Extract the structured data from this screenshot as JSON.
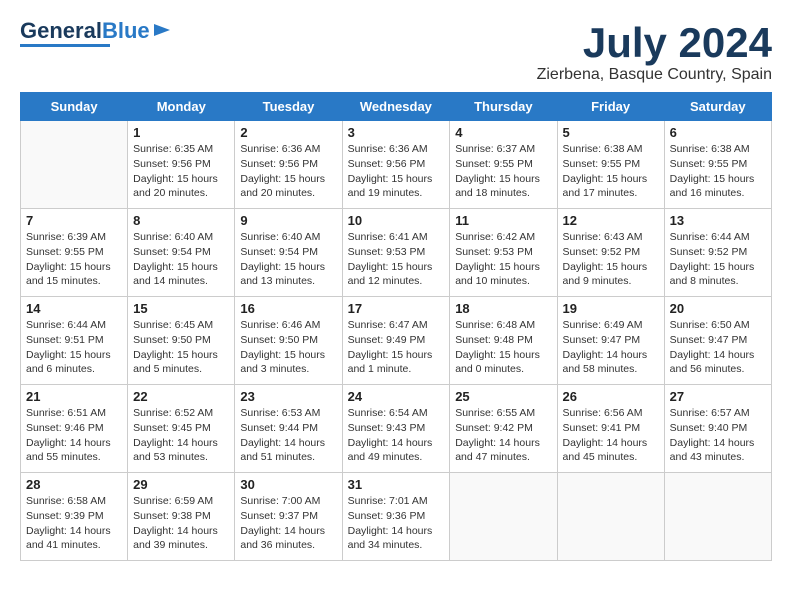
{
  "header": {
    "logo": {
      "line1": "General",
      "line2": "Blue"
    },
    "title": "July 2024",
    "location": "Zierbena, Basque Country, Spain"
  },
  "weekdays": [
    "Sunday",
    "Monday",
    "Tuesday",
    "Wednesday",
    "Thursday",
    "Friday",
    "Saturday"
  ],
  "weeks": [
    [
      {
        "day": "",
        "info": ""
      },
      {
        "day": "1",
        "info": "Sunrise: 6:35 AM\nSunset: 9:56 PM\nDaylight: 15 hours\nand 20 minutes."
      },
      {
        "day": "2",
        "info": "Sunrise: 6:36 AM\nSunset: 9:56 PM\nDaylight: 15 hours\nand 20 minutes."
      },
      {
        "day": "3",
        "info": "Sunrise: 6:36 AM\nSunset: 9:56 PM\nDaylight: 15 hours\nand 19 minutes."
      },
      {
        "day": "4",
        "info": "Sunrise: 6:37 AM\nSunset: 9:55 PM\nDaylight: 15 hours\nand 18 minutes."
      },
      {
        "day": "5",
        "info": "Sunrise: 6:38 AM\nSunset: 9:55 PM\nDaylight: 15 hours\nand 17 minutes."
      },
      {
        "day": "6",
        "info": "Sunrise: 6:38 AM\nSunset: 9:55 PM\nDaylight: 15 hours\nand 16 minutes."
      }
    ],
    [
      {
        "day": "7",
        "info": "Sunrise: 6:39 AM\nSunset: 9:55 PM\nDaylight: 15 hours\nand 15 minutes."
      },
      {
        "day": "8",
        "info": "Sunrise: 6:40 AM\nSunset: 9:54 PM\nDaylight: 15 hours\nand 14 minutes."
      },
      {
        "day": "9",
        "info": "Sunrise: 6:40 AM\nSunset: 9:54 PM\nDaylight: 15 hours\nand 13 minutes."
      },
      {
        "day": "10",
        "info": "Sunrise: 6:41 AM\nSunset: 9:53 PM\nDaylight: 15 hours\nand 12 minutes."
      },
      {
        "day": "11",
        "info": "Sunrise: 6:42 AM\nSunset: 9:53 PM\nDaylight: 15 hours\nand 10 minutes."
      },
      {
        "day": "12",
        "info": "Sunrise: 6:43 AM\nSunset: 9:52 PM\nDaylight: 15 hours\nand 9 minutes."
      },
      {
        "day": "13",
        "info": "Sunrise: 6:44 AM\nSunset: 9:52 PM\nDaylight: 15 hours\nand 8 minutes."
      }
    ],
    [
      {
        "day": "14",
        "info": "Sunrise: 6:44 AM\nSunset: 9:51 PM\nDaylight: 15 hours\nand 6 minutes."
      },
      {
        "day": "15",
        "info": "Sunrise: 6:45 AM\nSunset: 9:50 PM\nDaylight: 15 hours\nand 5 minutes."
      },
      {
        "day": "16",
        "info": "Sunrise: 6:46 AM\nSunset: 9:50 PM\nDaylight: 15 hours\nand 3 minutes."
      },
      {
        "day": "17",
        "info": "Sunrise: 6:47 AM\nSunset: 9:49 PM\nDaylight: 15 hours\nand 1 minute."
      },
      {
        "day": "18",
        "info": "Sunrise: 6:48 AM\nSunset: 9:48 PM\nDaylight: 15 hours\nand 0 minutes."
      },
      {
        "day": "19",
        "info": "Sunrise: 6:49 AM\nSunset: 9:47 PM\nDaylight: 14 hours\nand 58 minutes."
      },
      {
        "day": "20",
        "info": "Sunrise: 6:50 AM\nSunset: 9:47 PM\nDaylight: 14 hours\nand 56 minutes."
      }
    ],
    [
      {
        "day": "21",
        "info": "Sunrise: 6:51 AM\nSunset: 9:46 PM\nDaylight: 14 hours\nand 55 minutes."
      },
      {
        "day": "22",
        "info": "Sunrise: 6:52 AM\nSunset: 9:45 PM\nDaylight: 14 hours\nand 53 minutes."
      },
      {
        "day": "23",
        "info": "Sunrise: 6:53 AM\nSunset: 9:44 PM\nDaylight: 14 hours\nand 51 minutes."
      },
      {
        "day": "24",
        "info": "Sunrise: 6:54 AM\nSunset: 9:43 PM\nDaylight: 14 hours\nand 49 minutes."
      },
      {
        "day": "25",
        "info": "Sunrise: 6:55 AM\nSunset: 9:42 PM\nDaylight: 14 hours\nand 47 minutes."
      },
      {
        "day": "26",
        "info": "Sunrise: 6:56 AM\nSunset: 9:41 PM\nDaylight: 14 hours\nand 45 minutes."
      },
      {
        "day": "27",
        "info": "Sunrise: 6:57 AM\nSunset: 9:40 PM\nDaylight: 14 hours\nand 43 minutes."
      }
    ],
    [
      {
        "day": "28",
        "info": "Sunrise: 6:58 AM\nSunset: 9:39 PM\nDaylight: 14 hours\nand 41 minutes."
      },
      {
        "day": "29",
        "info": "Sunrise: 6:59 AM\nSunset: 9:38 PM\nDaylight: 14 hours\nand 39 minutes."
      },
      {
        "day": "30",
        "info": "Sunrise: 7:00 AM\nSunset: 9:37 PM\nDaylight: 14 hours\nand 36 minutes."
      },
      {
        "day": "31",
        "info": "Sunrise: 7:01 AM\nSunset: 9:36 PM\nDaylight: 14 hours\nand 34 minutes."
      },
      {
        "day": "",
        "info": ""
      },
      {
        "day": "",
        "info": ""
      },
      {
        "day": "",
        "info": ""
      }
    ]
  ]
}
